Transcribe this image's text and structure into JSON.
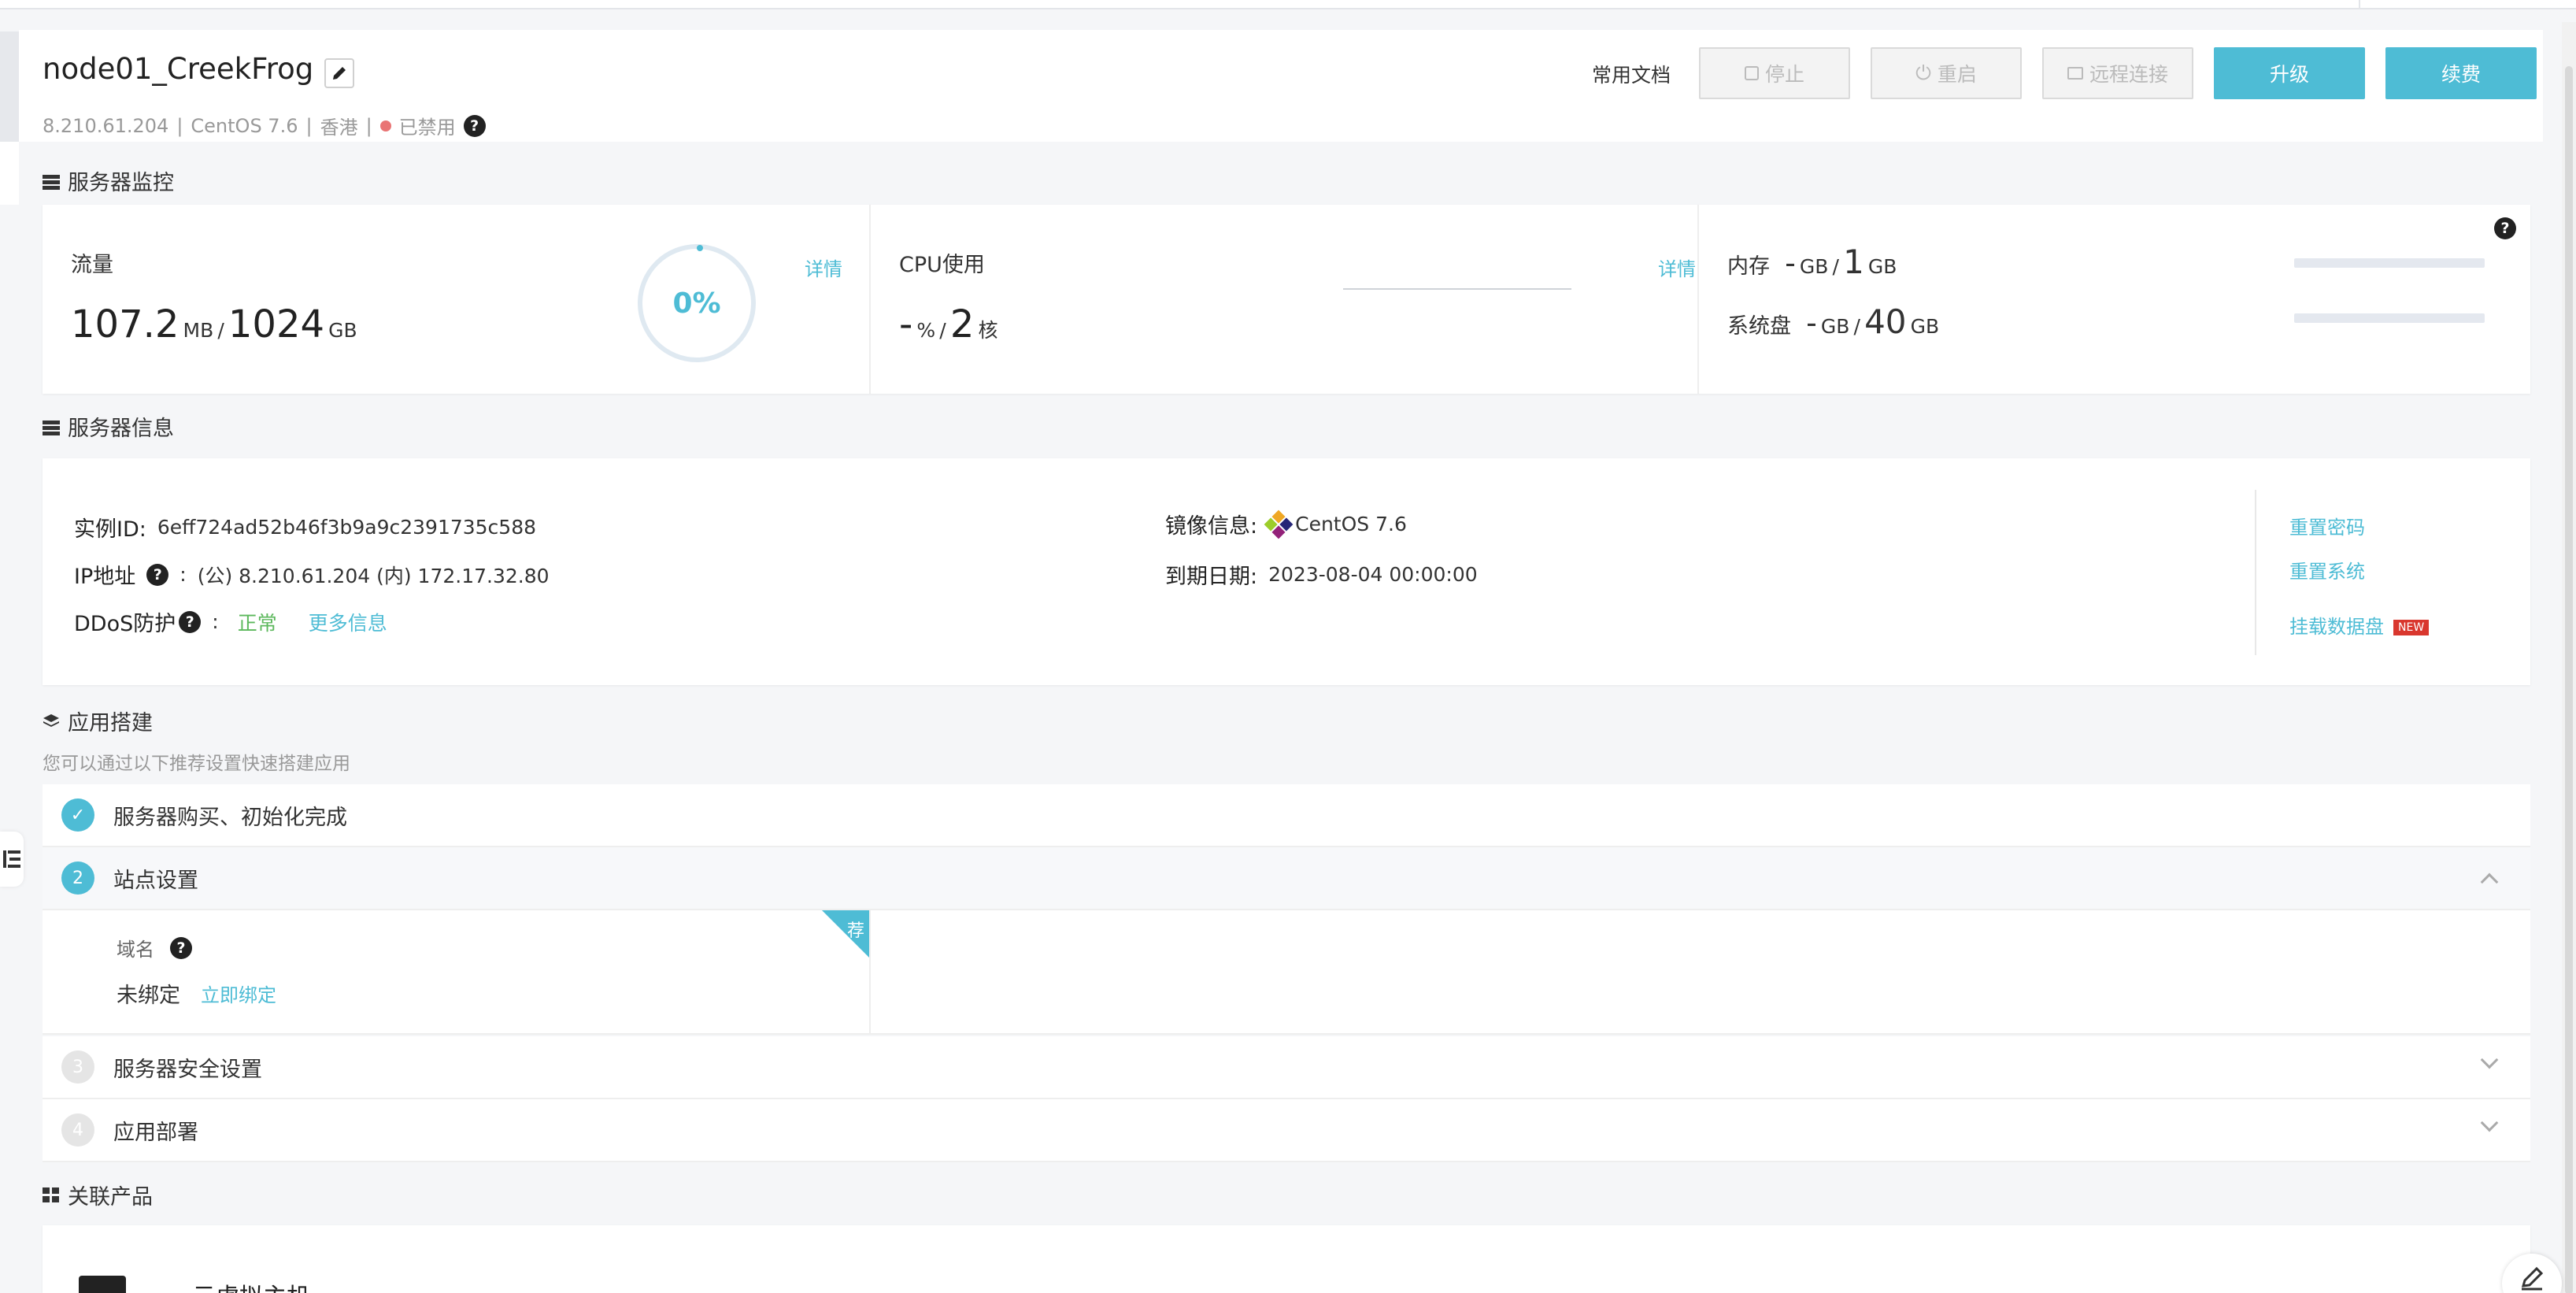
{
  "header": {
    "server_name": "node01_CreekFrog",
    "ip": "8.210.61.204",
    "os": "CentOS 7.6",
    "region": "香港",
    "status": "已禁用",
    "sep": "|",
    "help": "?",
    "doc_link": "常用文档",
    "buttons": {
      "stop": "停止",
      "restart": "重启",
      "remote": "远程连接",
      "upgrade": "升级",
      "renew": "续费"
    }
  },
  "monitor": {
    "title": "服务器监控",
    "traffic": {
      "label": "流量",
      "used": "107.2",
      "used_unit": "MB",
      "total": "1024",
      "total_unit": "GB",
      "percent": "0%",
      "percent_value": 0,
      "detail": "详情"
    },
    "cpu": {
      "label": "CPU使用",
      "value": "-",
      "value_unit": "%",
      "cores": "2",
      "cores_unit": "核",
      "detail": "详情"
    },
    "memory": {
      "label": "内存",
      "used": "-",
      "used_unit": "GB",
      "total": "1",
      "total_unit": "GB",
      "fraction": 0
    },
    "disk": {
      "label": "系统盘",
      "used": "-",
      "used_unit": "GB",
      "total": "40",
      "total_unit": "GB",
      "fraction": 0
    },
    "help": "?",
    "slash": "/"
  },
  "info": {
    "title": "服务器信息",
    "instance_id_label": "实例ID:",
    "instance_id": "6eff724ad52b46f3b9a9c2391735c588",
    "ip_label": "IP地址",
    "ip_colon": ":",
    "ip_value": "(公) 8.210.61.204 (内) 172.17.32.80",
    "ddos_label": "DDoS防护",
    "ddos_colon": ":",
    "ddos_status": "正常",
    "ddos_more": "更多信息",
    "image_label": "镜像信息:",
    "image_value": "CentOS 7.6",
    "expire_label": "到期日期:",
    "expire_value": "2023-08-04 00:00:00",
    "actions": {
      "reset_password": "重置密码",
      "reset_system": "重置系统",
      "mount_disk": "挂载数据盘",
      "new_badge": "NEW"
    }
  },
  "app": {
    "title": "应用搭建",
    "subtitle": "您可以通过以下推荐设置快速搭建应用",
    "steps": [
      {
        "num": "✓",
        "label": "服务器购买、初始化完成"
      },
      {
        "num": "2",
        "label": "站点设置"
      },
      {
        "num": "3",
        "label": "服务器安全设置"
      },
      {
        "num": "4",
        "label": "应用部署"
      }
    ],
    "domain_label": "域名",
    "domain_status": "未绑定",
    "bind_now": "立即绑定",
    "ribbon": "荐"
  },
  "related": {
    "title": "关联产品",
    "item_label": "云虚拟主机"
  },
  "colors": {
    "accent": "#4ebcd5",
    "danger": "#e97474",
    "ok": "#5cb85c",
    "badge": "#d9372e"
  }
}
